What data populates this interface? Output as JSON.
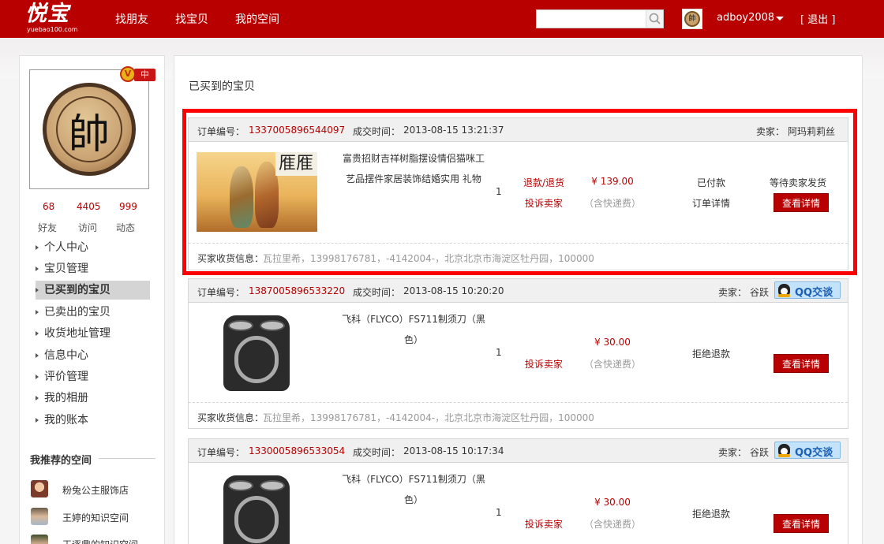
{
  "header": {
    "logo_text": "悦宝",
    "logo_sub": "yuebao100.com",
    "nav": [
      "找朋友",
      "找宝贝",
      "我的空间"
    ],
    "search_placeholder": "",
    "username": "adboy2008",
    "logout": "[ 退出 ]",
    "avatar_glyph": "帥"
  },
  "sidebar": {
    "avatar_glyph": "帥",
    "vip": {
      "letter": "V",
      "level": "中"
    },
    "stats": [
      {
        "value": "68",
        "label": "好友"
      },
      {
        "value": "4405",
        "label": "访问"
      },
      {
        "value": "999",
        "label": "动态"
      }
    ],
    "menu": [
      {
        "label": "个人中心",
        "active": false
      },
      {
        "label": "宝贝管理",
        "active": false
      },
      {
        "label": "已买到的宝贝",
        "active": true
      },
      {
        "label": "已卖出的宝贝",
        "active": false
      },
      {
        "label": "收货地址管理",
        "active": false
      },
      {
        "label": "信息中心",
        "active": false
      },
      {
        "label": "评价管理",
        "active": false
      },
      {
        "label": "我的相册",
        "active": false
      },
      {
        "label": "我的账本",
        "active": false
      }
    ],
    "recommend_title": "我推荐的空间",
    "recommend": [
      {
        "name": "粉兔公主服饰店"
      },
      {
        "name": "王婷的知识空间"
      },
      {
        "name": "王逐鼎的知识空间"
      }
    ]
  },
  "main": {
    "title": "已买到的宝贝",
    "labels": {
      "order_no": "订单编号：",
      "deal_time": "成交时间：",
      "seller": "卖家：",
      "buyer_addr": "买家收货信息：",
      "view_detail": "查看详情",
      "qq_chat": "QQ交谈"
    },
    "orders": [
      {
        "order_no": "1337005896544097",
        "deal_time": "2013-08-15 13:21:37",
        "seller": "阿玛莉莉丝",
        "title_line1": "富贵招财吉祥树脂摆设情侣猫咪工",
        "title_line2": "艺品摆件家居装饰结婚实用 礼物",
        "qty": "1",
        "refund": "退款/退货",
        "complain": "投诉卖家",
        "price": "¥ 139.00",
        "shipping": "（含快递费）",
        "status": "已付款",
        "order_detail": "订单详情",
        "wait_status": "等待卖家发货",
        "address": "瓦拉里希，13998176781，-4142004-，北京北京市海淀区牡丹园，100000"
      },
      {
        "order_no": "1387005896533220",
        "deal_time": "2013-08-15 10:20:20",
        "seller": "谷跃",
        "title_line1": "飞科（FLYCO）FS711制须刀（黑",
        "title_line2": "色）",
        "qty": "1",
        "complain": "投诉卖家",
        "price": "¥ 30.00",
        "shipping": "（含快递费）",
        "status": "拒绝退款",
        "address": "瓦拉里希，13998176781，-4142004-，北京北京市海淀区牡丹园，100000"
      },
      {
        "order_no": "1330005896533054",
        "deal_time": "2013-08-15 10:17:34",
        "seller": "谷跃",
        "title_line1": "飞科（FLYCO）FS711制须刀（黑",
        "title_line2": "色）",
        "qty": "1",
        "complain": "投诉卖家",
        "price": "¥ 30.00",
        "shipping": "（含快递费）",
        "status": "拒绝退款"
      }
    ]
  },
  "colors": {
    "brand_red": "#b80000",
    "highlight": "#ff0000"
  }
}
